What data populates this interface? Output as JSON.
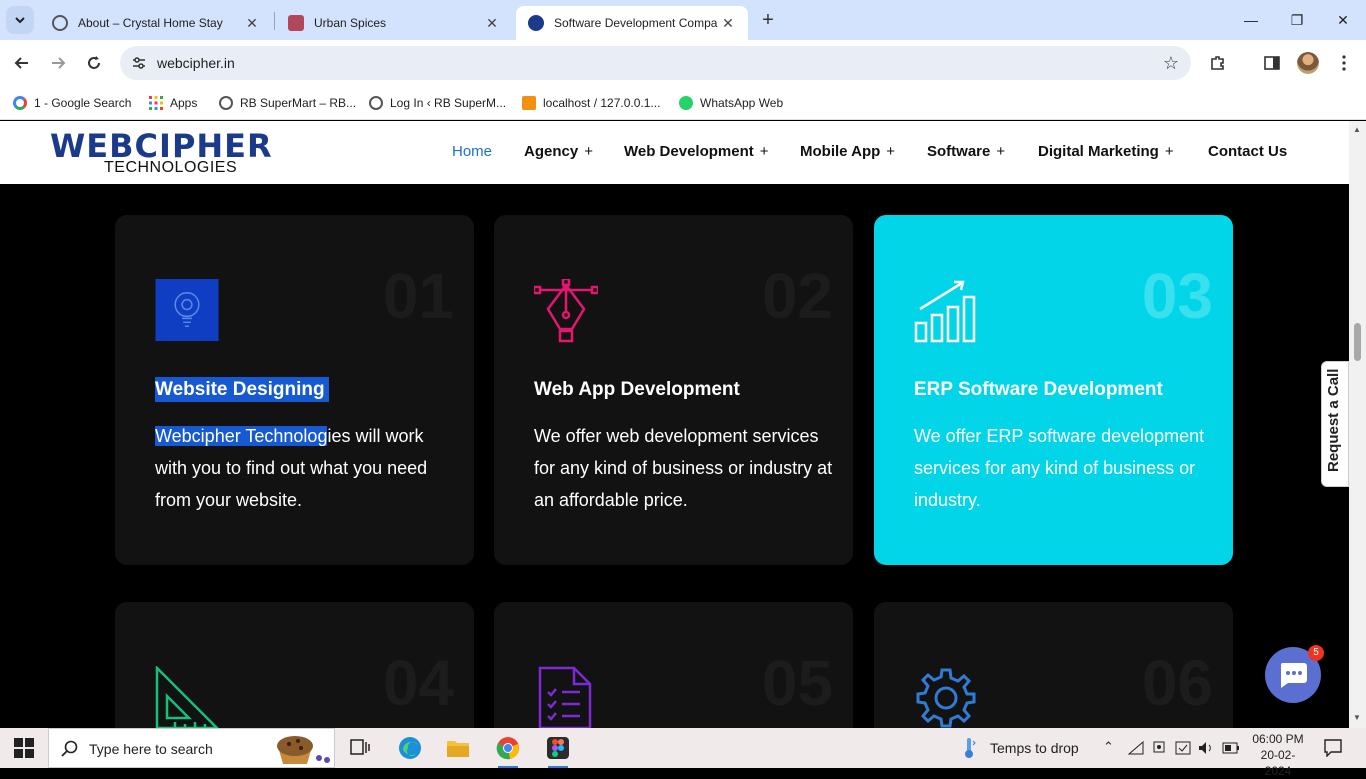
{
  "browser": {
    "tabs": [
      {
        "title": "About – Crystal Home Stay",
        "close": "✕"
      },
      {
        "title": "Urban Spices",
        "close": "✕"
      },
      {
        "title": "Software Development Compa",
        "close": "✕",
        "active": true
      }
    ],
    "new_tab": "+",
    "window_controls": {
      "minimize": "—",
      "restore": "❐",
      "close": "✕"
    },
    "url": "webcipher.in",
    "bookmarks": [
      {
        "label": "1 - Google Search",
        "icon": "google-icon"
      },
      {
        "label": "Apps",
        "icon": "apps-grid-icon"
      },
      {
        "label": "RB SuperMart – RB...",
        "icon": "globe-icon"
      },
      {
        "label": "Log In ‹ RB SuperM...",
        "icon": "globe-icon"
      },
      {
        "label": "localhost / 127.0.0.1...",
        "icon": "phpmyadmin-icon"
      },
      {
        "label": "WhatsApp Web",
        "icon": "whatsapp-icon"
      }
    ]
  },
  "site": {
    "logo_main": "WEBCIPHER",
    "logo_sub": "TECHNOLOGIES",
    "menu": [
      {
        "label": "Home",
        "plus": ""
      },
      {
        "label": "Agency",
        "plus": "+"
      },
      {
        "label": "Web Development",
        "plus": "+"
      },
      {
        "label": "Mobile App",
        "plus": "+"
      },
      {
        "label": "Software",
        "plus": "+"
      },
      {
        "label": "Digital Marketing",
        "plus": "+"
      },
      {
        "label": "Contact Us",
        "plus": ""
      }
    ],
    "cards": [
      {
        "num": "01",
        "title": "Website Designing",
        "desc_sel": "Webcipher Technolog",
        "desc_rest": "ies will work with you to find out what you need from your website.",
        "icon": "bulb-gear-icon"
      },
      {
        "num": "02",
        "title": "Web App Development",
        "desc": "We offer web development services for any kind of business or industry at an affordable price.",
        "icon": "pen-tool-icon"
      },
      {
        "num": "03",
        "title": "ERP Software Development",
        "desc": "We offer ERP software development services for any kind of business or industry.",
        "icon": "growth-chart-icon"
      },
      {
        "num": "04",
        "icon": "set-square-icon"
      },
      {
        "num": "05",
        "icon": "checklist-icon"
      },
      {
        "num": "06",
        "icon": "gear-icon"
      }
    ],
    "request_call": "Request a Call",
    "chat_badge": "5",
    "colors": {
      "accent": "#02d5e8",
      "menu_active": "#1a6fd1",
      "card_bg": "#121212"
    }
  },
  "taskbar": {
    "search_placeholder": "Type here to search",
    "weather": "Temps to drop",
    "time": "06:00 PM",
    "date": "20-02-2024"
  }
}
